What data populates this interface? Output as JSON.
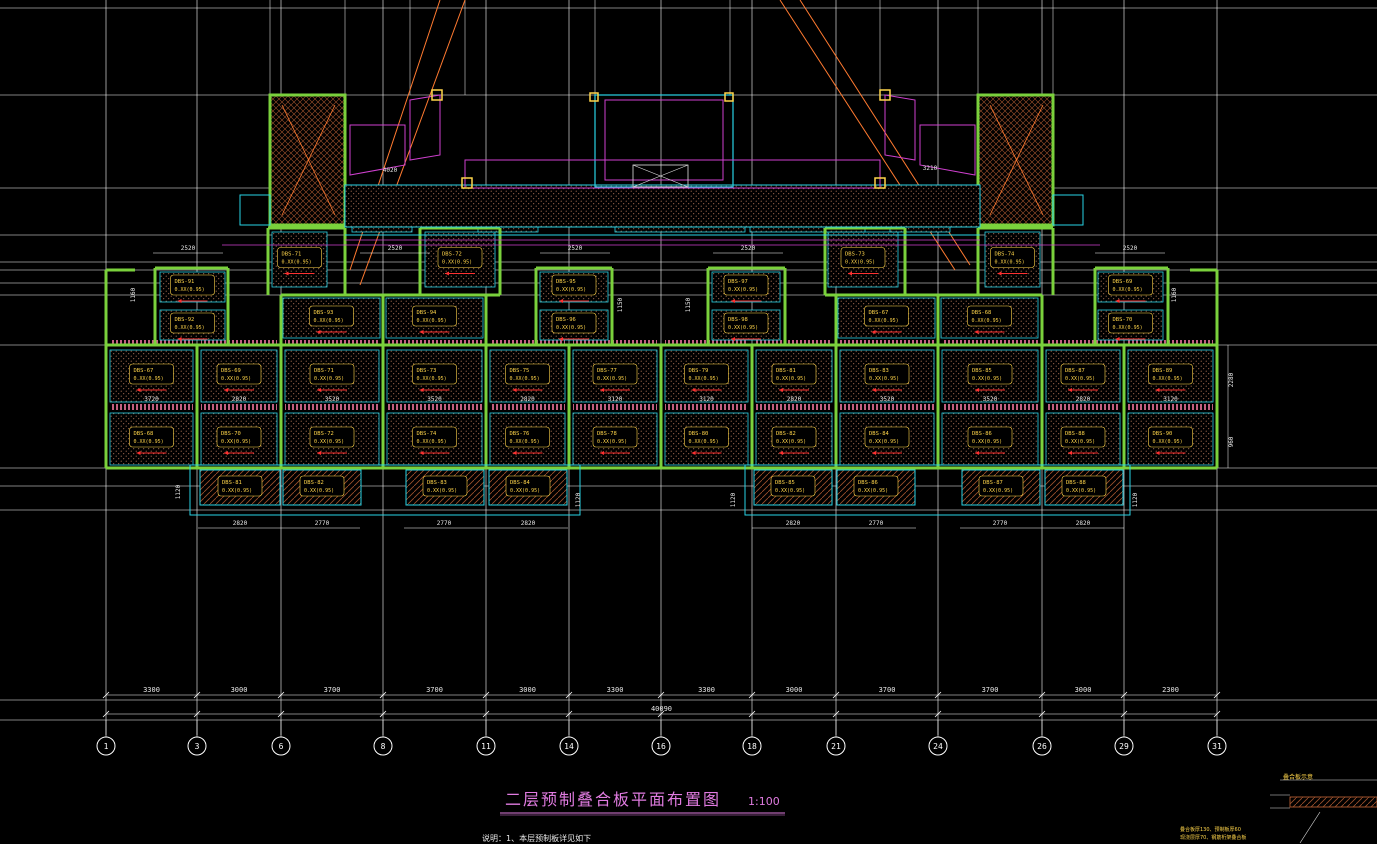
{
  "drawing": {
    "title": "二层预制叠合板平面布置图",
    "scale": "1:100",
    "note": "说明：1、本层预制板详见如下",
    "legend_title": "叠合板示意",
    "legend_note_1": "叠合板厚130、预制板厚60",
    "legend_note_2": "现浇层厚70、钢筋桁架叠合板"
  },
  "axes": {
    "labels": [
      "1",
      "3",
      "6",
      "8",
      "11",
      "14",
      "16",
      "18",
      "21",
      "24",
      "26",
      "29",
      "31"
    ],
    "spacings": [
      "3300",
      "3000",
      "3700",
      "3700",
      "3000",
      "3300",
      "3300",
      "3000",
      "3700",
      "3700",
      "3000",
      "2300"
    ],
    "overall": "40090"
  },
  "dims": {
    "top_row": [
      "2520",
      "2520",
      "2520",
      "2520",
      "2520"
    ],
    "mid_row": [
      "3720",
      "2820",
      "3520",
      "3520",
      "2820",
      "3120",
      "3120",
      "2820",
      "3520",
      "3520",
      "2820",
      "3120"
    ],
    "bottom_row": [
      "2820",
      "2770",
      "2770",
      "2820",
      "2820",
      "2770",
      "2770",
      "2820"
    ],
    "upper": [
      "4020",
      "3210"
    ],
    "vertical": [
      "1150",
      "1160",
      "1120",
      "2280",
      "960"
    ]
  },
  "panel_tags": [
    "DBS-67",
    "DBS-68",
    "DBS-69",
    "DBS-70",
    "DBS-71",
    "DBS-72",
    "DBS-73",
    "DBS-74",
    "DBS-75",
    "DBS-76",
    "DBS-77",
    "DBS-78",
    "DBS-79",
    "DBS-80",
    "DBS-81",
    "DBS-82",
    "DBS-83",
    "DBS-84",
    "DBS-85",
    "DBS-86",
    "DBS-87",
    "DBS-88",
    "DBS-89",
    "DBS-90",
    "DBS-91",
    "DBS-92",
    "DBS-93",
    "DBS-94",
    "DBS-95",
    "DBS-96",
    "DBS-97",
    "DBS-98"
  ],
  "panel_sub": "0.XX(0.95)",
  "colors": {
    "grid": "#ffffff",
    "wall": "#7ad13c",
    "beam": "#29d3e6",
    "magenta": "#d040d0",
    "orange": "#ff7a30",
    "hatch": "#a0522d",
    "label": "#ffd54a",
    "arrow": "#ff3030"
  }
}
